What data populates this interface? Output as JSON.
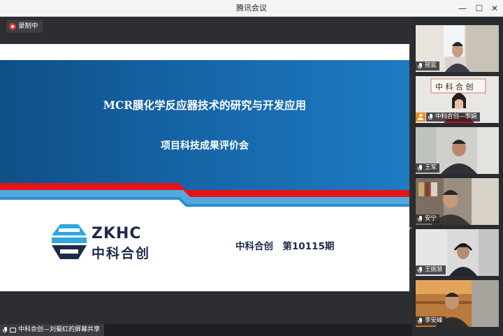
{
  "window": {
    "title": "腾讯会议",
    "minimize": "—",
    "maximize": "☐",
    "close": "✕"
  },
  "recording": {
    "label": "录制中",
    "icon": "cloud-record-icon",
    "color": "#e03535"
  },
  "slide": {
    "title_line1": "MCR膜化学反应器技术的研究与开发应用",
    "title_line2": "项目科技成果评价会",
    "logo_en": "ZKHC",
    "logo_cn": "中科合创",
    "issue_text": "中科合创　第10115期",
    "colors": {
      "band": "#1564a6",
      "red_stripe": "#e1141a",
      "light_stripe": "#55a8db",
      "logo_navy": "#1d2a4b",
      "logo_cyan": "#2fa7df"
    }
  },
  "share": {
    "label": "中科合创—刘菊红的屏幕共享"
  },
  "participants": [
    {
      "name": "邢奕",
      "mic": "muted"
    },
    {
      "name": "中科合创—李娟",
      "mic": "muted",
      "host": true
    },
    {
      "name": "王军",
      "mic": "muted"
    },
    {
      "name": "安宁",
      "mic": "on"
    },
    {
      "name": "王婉慧",
      "mic": "muted"
    },
    {
      "name": "李安峰",
      "mic": "muted"
    }
  ]
}
